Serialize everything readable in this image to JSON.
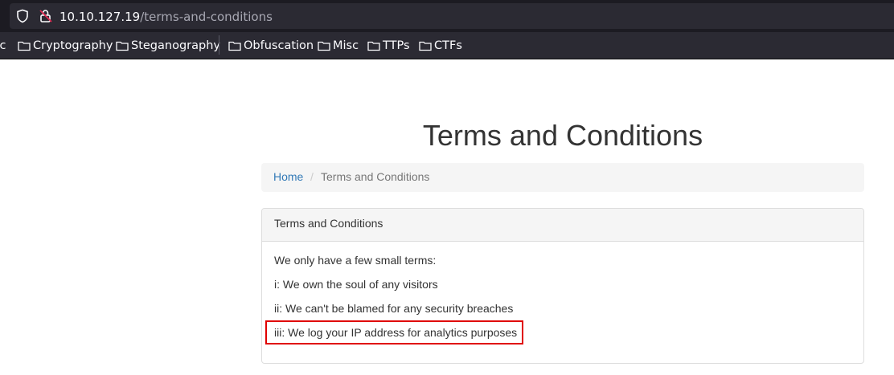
{
  "browser": {
    "url_host": "10.10.127.19",
    "url_path": "/terms-and-conditions",
    "bookmarks": [
      {
        "label": "sc"
      },
      {
        "label": "Cryptography"
      },
      {
        "label": "Steganography"
      },
      {
        "label": "Obfuscation"
      },
      {
        "label": "Misc"
      },
      {
        "label": "TTPs"
      },
      {
        "label": "CTFs"
      }
    ]
  },
  "page": {
    "title": "Terms and Conditions",
    "breadcrumb": {
      "home": "Home",
      "separator": "/",
      "current": "Terms and Conditions"
    },
    "panel": {
      "heading": "Terms and Conditions",
      "intro": "We only have a few small terms:",
      "terms": [
        "i: We own the soul of any visitors",
        "ii: We can't be blamed for any security breaches",
        "iii: We log your IP address for analytics purposes"
      ]
    }
  },
  "colors": {
    "link": "#337ab7",
    "highlight_border": "#e00000",
    "chrome_bg": "#2b2a33"
  }
}
